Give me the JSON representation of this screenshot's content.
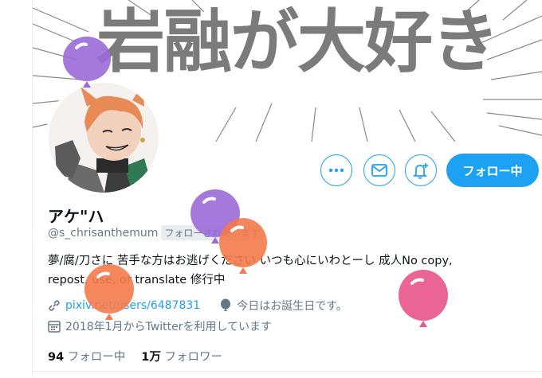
{
  "banner": {
    "text": "岩融が大好き"
  },
  "actions": {
    "follow_label": "フォロー中"
  },
  "profile": {
    "name": "アケ\"ハ",
    "handle": "@s_chrisanthemum",
    "follows_you": "フォローされています",
    "bio_line1": "夢/腐/刀さに 苦手な方はお逃げください いつも心にいわとーし 成人No copy,",
    "bio_line2": "repost, use, or translate 修行中",
    "website": "pixiv.net/users/6487831",
    "birthday": "今日はお誕生日です。",
    "joined": "2018年1月からTwitterを利用しています"
  },
  "stats": {
    "following_count": "94",
    "following_label": "フォロー中",
    "followers_count": "1万",
    "followers_label": "フォロワー"
  },
  "colors": {
    "accent": "#1da1f2",
    "balloon_purple": "#9b6ad8",
    "balloon_orange": "#f47a4a",
    "balloon_pink": "#e8588a"
  }
}
